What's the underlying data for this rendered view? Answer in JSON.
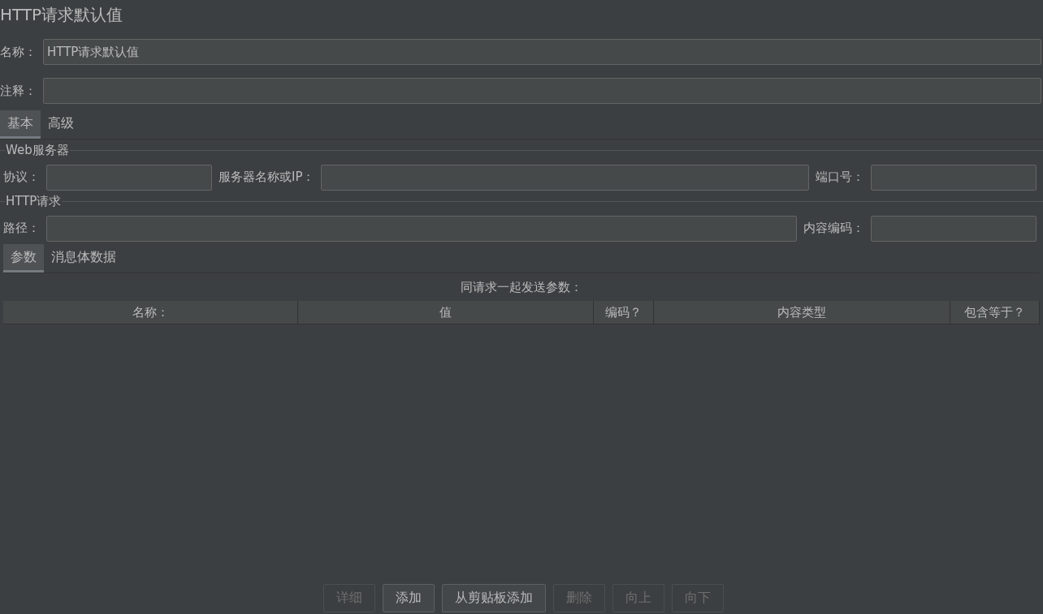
{
  "title": "HTTP请求默认值",
  "name_field": {
    "label": "名称：",
    "value": "HTTP请求默认值"
  },
  "comment_field": {
    "label": "注释："
  },
  "tabs": [
    {
      "label": "基本",
      "selected": true
    },
    {
      "label": "高级",
      "selected": false
    }
  ],
  "web_server": {
    "legend": "Web服务器",
    "protocol_label": "协议：",
    "server_label": "服务器名称或IP：",
    "port_label": "端口号："
  },
  "http_request": {
    "legend": "HTTP请求",
    "path_label": "路径：",
    "encoding_label": "内容编码："
  },
  "sub_tabs": [
    {
      "label": "参数",
      "selected": true
    },
    {
      "label": "消息体数据",
      "selected": false
    }
  ],
  "table": {
    "caption": "同请求一起发送参数：",
    "columns": [
      "名称：",
      "值",
      "编码？",
      "内容类型",
      "包含等于？"
    ]
  },
  "buttons": [
    {
      "label": "详细",
      "disabled": true
    },
    {
      "label": "添加",
      "disabled": false
    },
    {
      "label": "从剪贴板添加",
      "disabled": false
    },
    {
      "label": "删除",
      "disabled": true
    },
    {
      "label": "向上",
      "disabled": true
    },
    {
      "label": "向下",
      "disabled": true
    }
  ]
}
